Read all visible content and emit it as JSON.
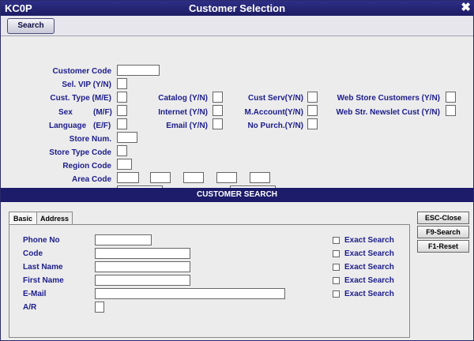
{
  "window": {
    "app_code": "KC0P",
    "title": "Customer Selection",
    "close_glyph": "✖"
  },
  "toolbar": {
    "search_label": "Search"
  },
  "form": {
    "customer_code": "Customer  Code",
    "sel_vip": "Sel. VIP (Y/N)",
    "cust_type": "Cust. Type (M/E)",
    "catalog": "Catalog (Y/N)",
    "cust_serv": "Cust Serv(Y/N)",
    "web_store_customers": "Web Store Customers (Y/N)",
    "sex": "Sex",
    "sex_opts": "(M/F)",
    "internet": "Internet (Y/N)",
    "m_account": "M.Account(Y/N)",
    "web_newsletter": "Web Str. Newslet Cust (Y/N)",
    "language": "Language",
    "language_opts": "(E/F)",
    "email": "Email (Y/N)",
    "no_purch": "No Purch.(Y/N)",
    "store_num": "Store Num.",
    "store_type_code": "Store Type Code",
    "region_code": "Region Code",
    "area_code": "Area Code"
  },
  "search_panel": {
    "header": "CUSTOMER SEARCH",
    "tabs": [
      "Basic",
      "Address"
    ],
    "fields": {
      "phone": "Phone No",
      "code": "Code",
      "last_name": "Last Name",
      "first_name": "First Name",
      "email": "E-Mail",
      "ar": "A/R"
    },
    "exact_search": "Exact Search",
    "buttons": {
      "esc": "ESC-Close",
      "f9": "F9-Search",
      "f1": "F1-Reset"
    }
  }
}
